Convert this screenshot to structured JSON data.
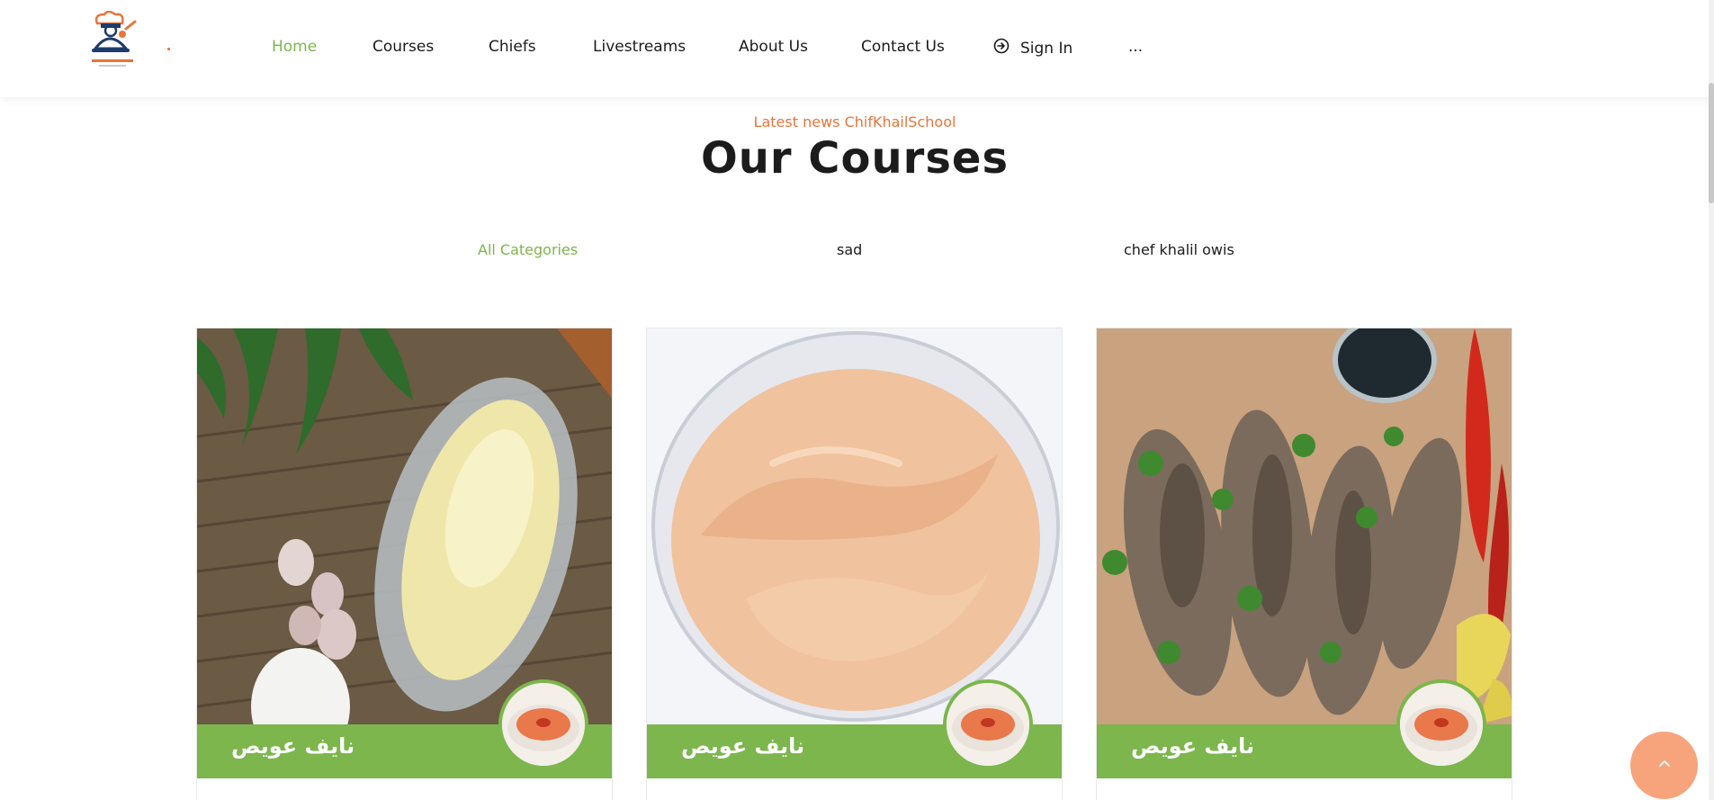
{
  "nav": {
    "home": "Home",
    "courses": "Courses",
    "chiefs": "Chiefs",
    "livestreams": "Livestreams",
    "about": "About Us",
    "contact": "Contact Us",
    "signin": "Sign In",
    "more": "..."
  },
  "section": {
    "subtitle": "Latest news ChifKhailSchool",
    "title": "Our Courses"
  },
  "filters": [
    "All Categories",
    "sad",
    "chef khalil owis"
  ],
  "cards": [
    {
      "author": "نايف عويص",
      "image": "mayonnaise-garlic-photo"
    },
    {
      "author": "نايف عويص",
      "image": "pink-sauce-photo"
    },
    {
      "author": "نايف عويص",
      "image": "grilled-fish-photo"
    }
  ],
  "icons": {
    "signin": "sign-in-icon",
    "to_top": "chevron-up-icon",
    "logo": "chef-logo-icon"
  },
  "colors": {
    "accent_green": "#7cb64c",
    "accent_orange": "#e9743a",
    "to_top_bg": "#f7a47d"
  }
}
